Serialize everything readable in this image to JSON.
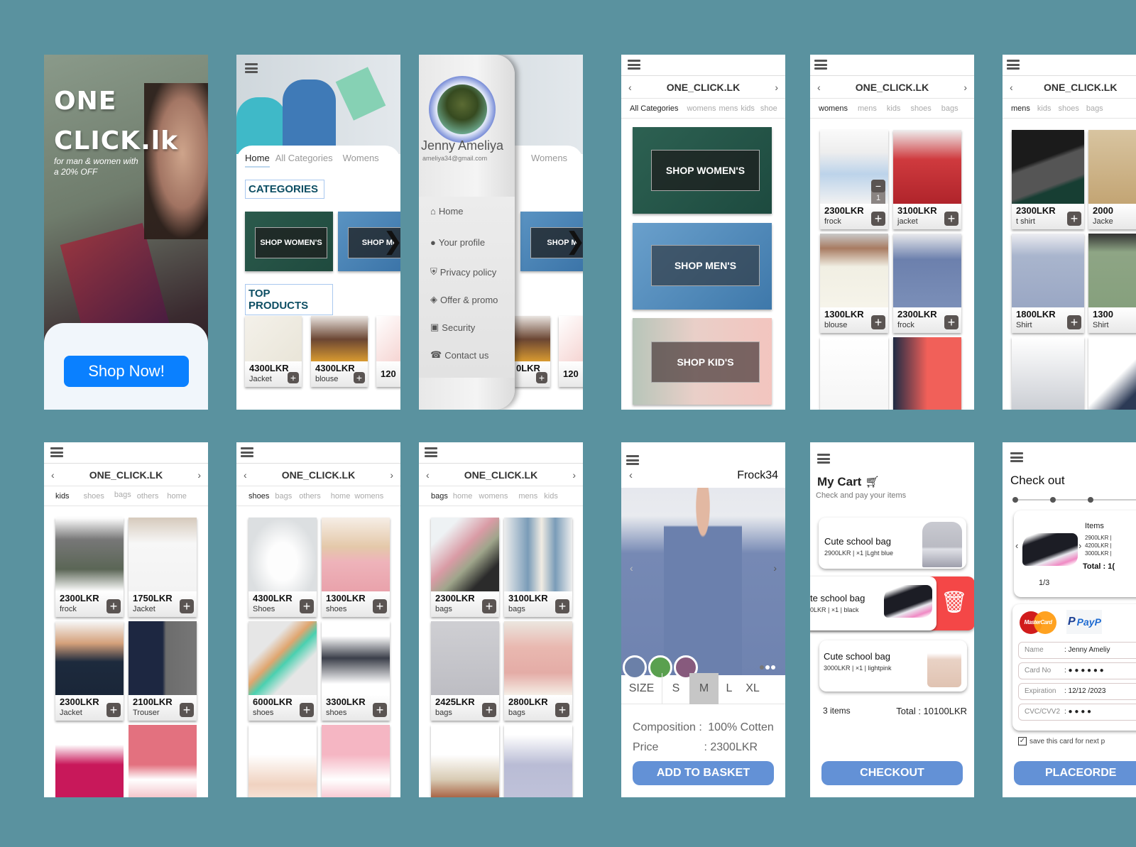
{
  "brand": "ONE_CLICK.LK",
  "splash": {
    "title_line1": "ONE",
    "title_line2": "CLICK.lk",
    "tagline_line1": "for man & women with",
    "tagline_line2": "a 20% OFF",
    "cta": "Shop Now!",
    "cta_color": "#0a80ff"
  },
  "home": {
    "tabs": [
      "Home",
      "All Categories",
      "Womens"
    ],
    "categories_heading": "CATEGORIES",
    "banners": [
      "SHOP WOMEN'S",
      "SHOP ME"
    ],
    "top_products_heading": "TOP PRODUCTS",
    "products": [
      {
        "price": "4300LKR",
        "name": "Jacket"
      },
      {
        "price": "4300LKR",
        "name": "blouse"
      },
      {
        "price": "120",
        "name": ""
      }
    ]
  },
  "drawer": {
    "user_name": "Jenny Ameliya",
    "email": "ameliya34@gmail.com",
    "items": [
      "Home",
      "Your profile",
      "Privacy policy",
      "Offer & promo",
      "Security",
      "Contact us"
    ],
    "bg_tab": "Womens",
    "bg_banner": "SHOP M",
    "bg_price": "0LKR",
    "bg_price2": "120"
  },
  "all_categories": {
    "tabs": [
      "All Categories",
      "womens",
      "mens",
      "kids",
      "shoe"
    ],
    "banners": [
      "SHOP WOMEN'S",
      "SHOP MEN'S",
      "SHOP KID'S"
    ]
  },
  "womens": {
    "tabs": [
      "womens",
      "mens",
      "kids",
      "shoes",
      "bags"
    ],
    "quantity": "1",
    "products": [
      {
        "price": "2300LKR",
        "name": "frock"
      },
      {
        "price": "3100LKR",
        "name": "jacket"
      },
      {
        "price": "1300LKR",
        "name": "blouse"
      },
      {
        "price": "2300LKR",
        "name": "frock"
      }
    ]
  },
  "mens": {
    "tabs": [
      "mens",
      "kids",
      "shoes",
      "bags"
    ],
    "products": [
      {
        "price": "2300LKR",
        "name": "t shirt"
      },
      {
        "price": "2000",
        "name": "Jacke"
      },
      {
        "price": "1800LKR",
        "name": "Shirt"
      },
      {
        "price": "1300",
        "name": "Shirt"
      }
    ]
  },
  "kids": {
    "tabs": [
      "kids",
      "shoes",
      "bags",
      "others",
      "home"
    ],
    "products": [
      {
        "price": "2300LKR",
        "name": "frock"
      },
      {
        "price": "1750LKR",
        "name": "Jacket"
      },
      {
        "price": "2300LKR",
        "name": "Jacket"
      },
      {
        "price": "2100LKR",
        "name": "Trouser"
      }
    ]
  },
  "shoes": {
    "tabs": [
      "shoes",
      "bags",
      "others",
      "home",
      "womens"
    ],
    "products": [
      {
        "price": "4300LKR",
        "name": "Shoes"
      },
      {
        "price": "1300LKR",
        "name": "shoes"
      },
      {
        "price": "6000LKR",
        "name": "shoes"
      },
      {
        "price": "3300LKR",
        "name": "shoes"
      }
    ]
  },
  "bags": {
    "tabs": [
      "bags",
      "home",
      "womens",
      "mens",
      "kids"
    ],
    "products": [
      {
        "price": "2300LKR",
        "name": "bags"
      },
      {
        "price": "3100LKR",
        "name": "bags"
      },
      {
        "price": "2425LKR",
        "name": "bags"
      },
      {
        "price": "2800LKR",
        "name": "bags"
      }
    ]
  },
  "product_detail": {
    "title": "Frock34",
    "colors": [
      "#6b80a8",
      "#5aa04f",
      "#875a7d"
    ],
    "size_label": "SIZE",
    "sizes": [
      "S",
      "M",
      "L",
      "XL"
    ],
    "selected_size": "M",
    "composition_label": "Composition :",
    "composition_value": "100% Cotten",
    "price_label": "Price",
    "price_value": ": 2300LKR",
    "cta": "ADD TO BASKET"
  },
  "cart": {
    "title": "My Cart",
    "subtitle": "Check and pay your items",
    "items": [
      {
        "name": "Cute school bag",
        "meta": "2900LKR |  ×1 |Lght blue"
      },
      {
        "name": "te school bag",
        "meta": "0LKR |  ×1 | black"
      },
      {
        "name": "Cute school bag",
        "meta": "3000LKR |  ×1 | lightpink"
      }
    ],
    "count": "3 items",
    "total": "Total : 10100LKR",
    "cta": "CHECKOUT",
    "delete_color": "#f24343"
  },
  "checkout": {
    "title": "Check out",
    "items_heading": "Items",
    "items_lines": [
      "2900LKR |",
      "4200LKR |",
      "3000LKR |"
    ],
    "total": "Total : 1(",
    "pager": "1/3",
    "mastercard": "MasterCard",
    "paypal": "PayP",
    "fields": [
      {
        "label": "Name",
        "value": ": Jenny Ameliy"
      },
      {
        "label": "Card No",
        "value": ":  ● ● ● ●  ● ●"
      },
      {
        "label": "Expiration",
        "value": ": 12/12 /2023"
      },
      {
        "label": "CVC/CVV2",
        "value": ":  ● ● ● ●"
      }
    ],
    "save_card": "save this card for next p",
    "cta": "PLACEORDE"
  }
}
